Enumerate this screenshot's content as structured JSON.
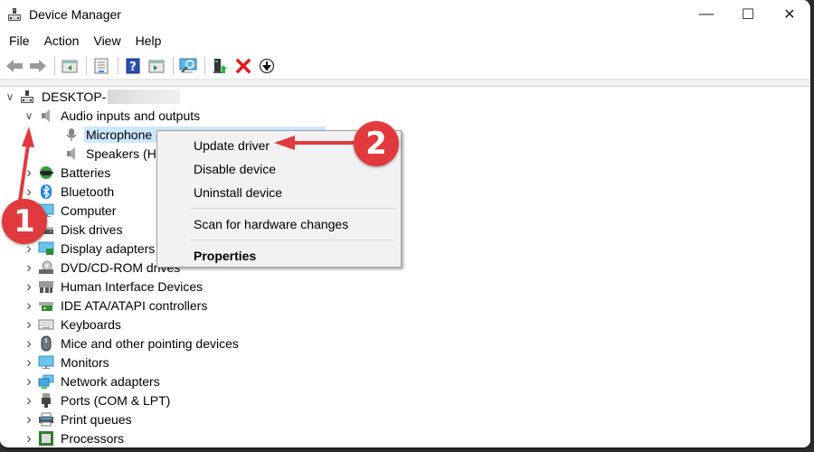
{
  "window": {
    "title": "Device Manager",
    "controls": {
      "minimize": "—",
      "maximize": "☐",
      "close": "✕"
    }
  },
  "menu": [
    "File",
    "Action",
    "View",
    "Help"
  ],
  "toolbar": [
    {
      "name": "back-icon"
    },
    {
      "name": "forward-icon"
    },
    {
      "sep": true
    },
    {
      "name": "show-hide-console-tree-icon"
    },
    {
      "sep": true
    },
    {
      "name": "properties-icon"
    },
    {
      "sep": true
    },
    {
      "name": "help-icon"
    },
    {
      "name": "show-action-pane-icon"
    },
    {
      "sep": true
    },
    {
      "name": "scan-hardware-icon"
    },
    {
      "sep": true
    },
    {
      "name": "update-driver-icon"
    },
    {
      "name": "uninstall-device-icon"
    },
    {
      "name": "enable-device-icon"
    }
  ],
  "tree": {
    "root": "DESKTOP-",
    "nodes": [
      {
        "label": "Audio inputs and outputs",
        "icon": "speaker",
        "expanded": true,
        "level": 1
      },
      {
        "label": "Microphone (High Definition Audio Device)",
        "icon": "microphone",
        "level": 2,
        "selected": true
      },
      {
        "label": "Speakers (High Definition Audio Device)",
        "icon": "speaker",
        "level": 2
      },
      {
        "label": "Batteries",
        "icon": "battery",
        "level": 1
      },
      {
        "label": "Bluetooth",
        "icon": "bluetooth",
        "level": 1
      },
      {
        "label": "Computer",
        "icon": "computer",
        "level": 1
      },
      {
        "label": "Disk drives",
        "icon": "disk",
        "level": 1
      },
      {
        "label": "Display adapters",
        "icon": "display",
        "level": 1
      },
      {
        "label": "DVD/CD-ROM drives",
        "icon": "dvd",
        "level": 1
      },
      {
        "label": "Human Interface Devices",
        "icon": "hid",
        "level": 1
      },
      {
        "label": "IDE ATA/ATAPI controllers",
        "icon": "ide",
        "level": 1
      },
      {
        "label": "Keyboards",
        "icon": "keyboard",
        "level": 1
      },
      {
        "label": "Mice and other pointing devices",
        "icon": "mouse",
        "level": 1
      },
      {
        "label": "Monitors",
        "icon": "monitor",
        "level": 1
      },
      {
        "label": "Network adapters",
        "icon": "network",
        "level": 1
      },
      {
        "label": "Ports (COM & LPT)",
        "icon": "port",
        "level": 1
      },
      {
        "label": "Print queues",
        "icon": "printer",
        "level": 1
      },
      {
        "label": "Processors",
        "icon": "processor",
        "level": 1
      }
    ]
  },
  "context_menu": {
    "items": [
      {
        "label": "Update driver"
      },
      {
        "label": "Disable device"
      },
      {
        "label": "Uninstall device"
      },
      {
        "sep": true
      },
      {
        "label": "Scan for hardware changes"
      },
      {
        "sep": true
      },
      {
        "label": "Properties",
        "bold": true
      }
    ]
  },
  "annotations": {
    "badge1": "1",
    "badge2": "2",
    "color": "#e03a3e"
  }
}
